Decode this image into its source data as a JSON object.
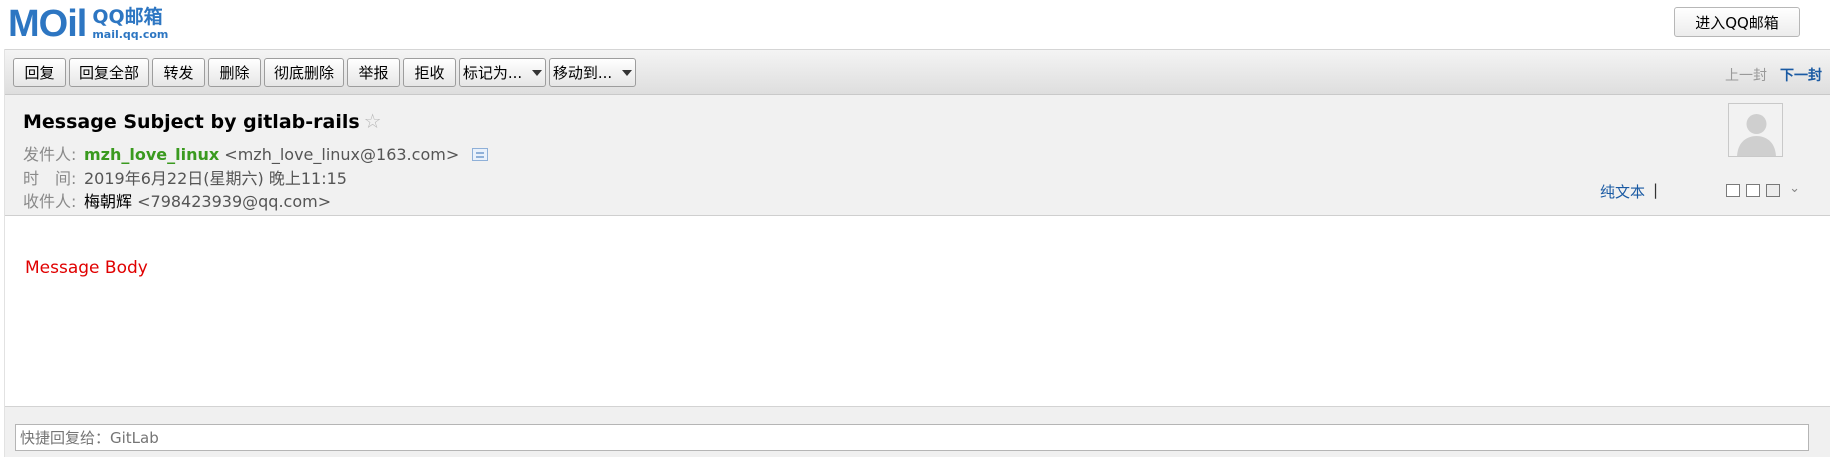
{
  "logo": {
    "mark": "MOil",
    "brand_line1": "QQ邮箱",
    "brand_line2": "mail.qq.com"
  },
  "topbar": {
    "enter_label": "进入QQ邮箱"
  },
  "toolbar": {
    "buttons": [
      "回复",
      "回复全部",
      "转发",
      "删除",
      "彻底删除",
      "举报",
      "拒收",
      "标记为...",
      "移动到..."
    ],
    "prev_label": "上一封",
    "next_label": "下一封"
  },
  "message": {
    "subject": "Message Subject by gitlab-rails",
    "star": "☆",
    "from_label": "发件人:",
    "from_name": "mzh_love_linux",
    "from_addr": "<mzh_love_linux@163.com>",
    "time_label": "时　间:",
    "time_value": "2019年6月22日(星期六) 晚上11:15",
    "to_label": "收件人:",
    "to_name": "梅朝辉",
    "to_addr": "<798423939@qq.com>",
    "plain_text_label": "纯文本",
    "separator": "|",
    "body": "Message Body"
  },
  "quick_reply": {
    "placeholder": "快捷回复给：GitLab"
  },
  "colors": {
    "brand": "#2d76c2",
    "sender": "#3a9a1f",
    "body_text": "#e00000",
    "link": "#1a5aa3"
  }
}
